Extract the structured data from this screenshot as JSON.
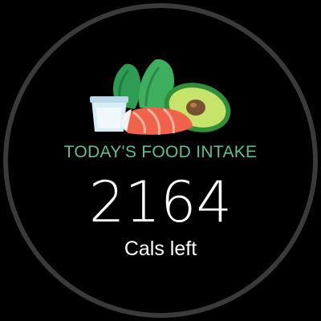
{
  "widget": {
    "icon": "food-plate-icon",
    "title": "TODAY'S FOOD INTAKE",
    "calories_left": "2164",
    "calories_label": "Cals left"
  },
  "colors": {
    "background": "#000000",
    "ring": "#3a3a3a",
    "accent": "#5fc28a",
    "text": "#ffffff"
  }
}
